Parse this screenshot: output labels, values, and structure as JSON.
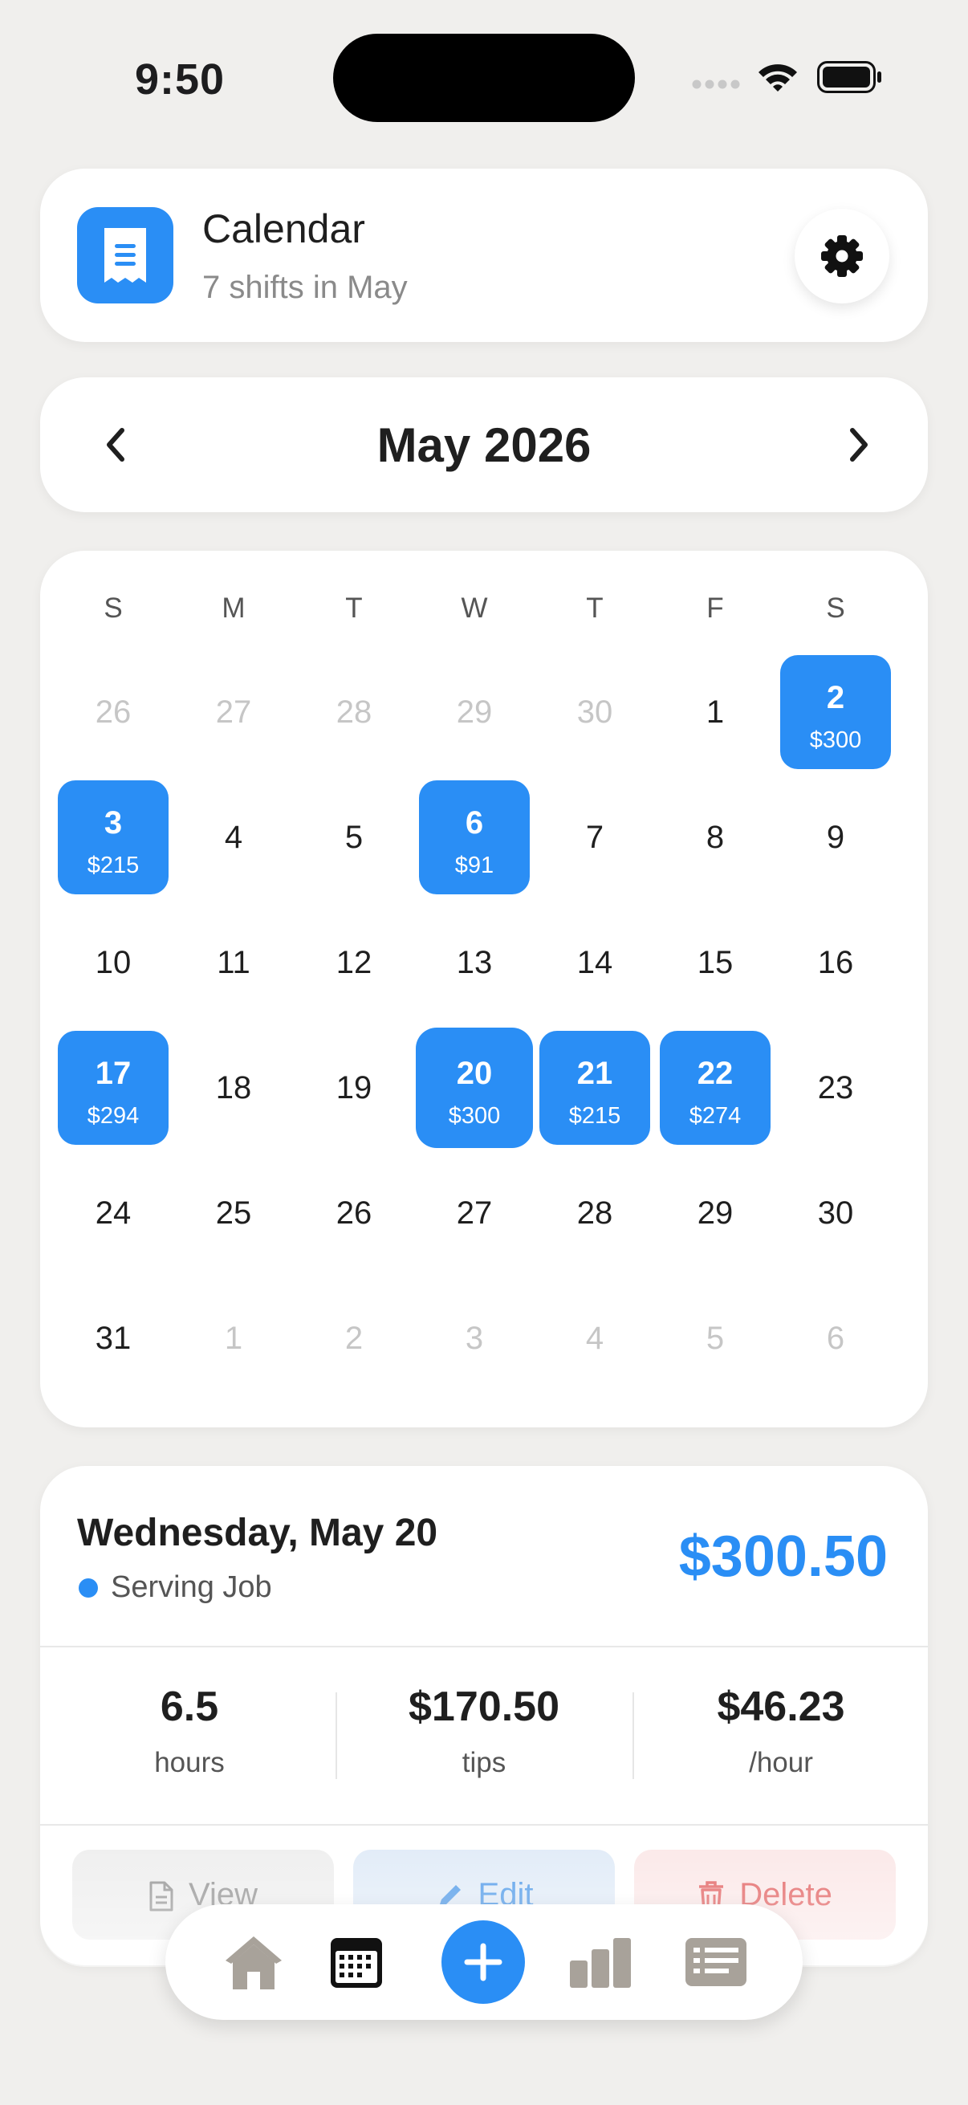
{
  "status_bar": {
    "time": "9:50"
  },
  "header": {
    "title": "Calendar",
    "subtitle": "7 shifts in May",
    "icon": "receipt-icon",
    "settings_icon": "gear-icon"
  },
  "month_nav": {
    "title": "May 2026",
    "prev_icon": "chevron-left-icon",
    "next_icon": "chevron-right-icon"
  },
  "calendar": {
    "weekdays": [
      "S",
      "M",
      "T",
      "W",
      "T",
      "F",
      "S"
    ],
    "weeks": [
      [
        {
          "day": "26",
          "muted": true
        },
        {
          "day": "27",
          "muted": true
        },
        {
          "day": "28",
          "muted": true
        },
        {
          "day": "29",
          "muted": true
        },
        {
          "day": "30",
          "muted": true
        },
        {
          "day": "1"
        },
        {
          "day": "2",
          "amount": "$300"
        }
      ],
      [
        {
          "day": "3",
          "amount": "$215"
        },
        {
          "day": "4"
        },
        {
          "day": "5"
        },
        {
          "day": "6",
          "amount": "$91"
        },
        {
          "day": "7"
        },
        {
          "day": "8"
        },
        {
          "day": "9"
        }
      ],
      [
        {
          "day": "10"
        },
        {
          "day": "11"
        },
        {
          "day": "12"
        },
        {
          "day": "13"
        },
        {
          "day": "14"
        },
        {
          "day": "15"
        },
        {
          "day": "16"
        }
      ],
      [
        {
          "day": "17",
          "amount": "$294"
        },
        {
          "day": "18"
        },
        {
          "day": "19"
        },
        {
          "day": "20",
          "amount": "$300",
          "selected": true
        },
        {
          "day": "21",
          "amount": "$215"
        },
        {
          "day": "22",
          "amount": "$274"
        },
        {
          "day": "23"
        }
      ],
      [
        {
          "day": "24"
        },
        {
          "day": "25"
        },
        {
          "day": "26"
        },
        {
          "day": "27"
        },
        {
          "day": "28"
        },
        {
          "day": "29"
        },
        {
          "day": "30"
        }
      ],
      [
        {
          "day": "31"
        },
        {
          "day": "1",
          "muted": true
        },
        {
          "day": "2",
          "muted": true
        },
        {
          "day": "3",
          "muted": true
        },
        {
          "day": "4",
          "muted": true
        },
        {
          "day": "5",
          "muted": true
        },
        {
          "day": "6",
          "muted": true
        }
      ]
    ]
  },
  "detail": {
    "date": "Wednesday, May 20",
    "job": "Serving Job",
    "total": "$300.50",
    "stats": [
      {
        "value": "6.5",
        "label": "hours"
      },
      {
        "value": "$170.50",
        "label": "tips"
      },
      {
        "value": "$46.23",
        "label": "/hour"
      }
    ],
    "actions": {
      "view": "View",
      "edit": "Edit",
      "delete": "Delete"
    }
  },
  "tabbar": {
    "items": [
      "home-icon",
      "calendar-icon",
      "add-icon",
      "bar-chart-icon",
      "list-icon"
    ]
  },
  "colors": {
    "accent": "#2a8ef5",
    "background": "#f0efed",
    "delete": "#e46b6b"
  }
}
